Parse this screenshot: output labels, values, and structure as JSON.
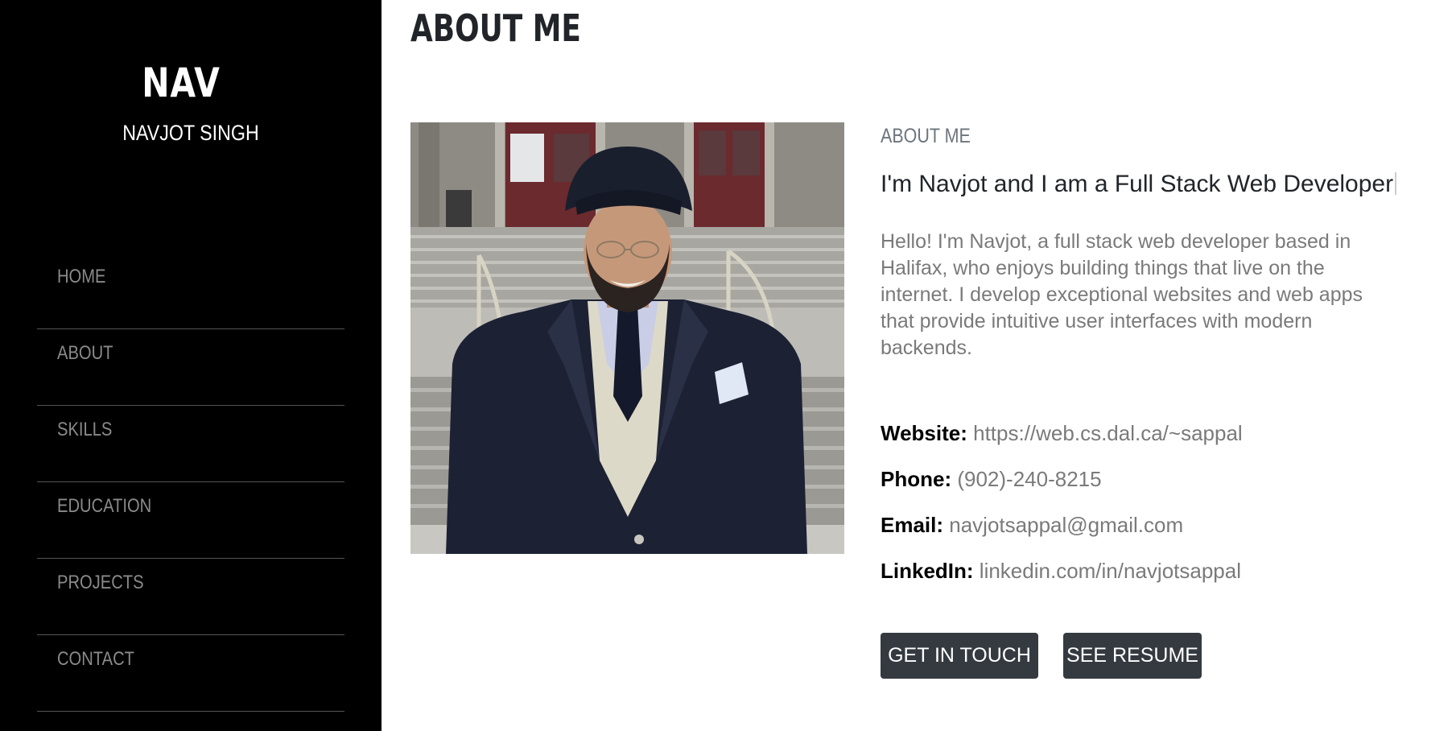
{
  "sidebar": {
    "logo": "NAV",
    "name": "NAVJOT SINGH",
    "nav_items": [
      {
        "label": "HOME"
      },
      {
        "label": "ABOUT"
      },
      {
        "label": "SKILLS"
      },
      {
        "label": "EDUCATION"
      },
      {
        "label": "PROJECTS"
      },
      {
        "label": "CONTACT"
      }
    ]
  },
  "main": {
    "page_title": "ABOUT ME",
    "section_label": "ABOUT ME",
    "headline": "I'm Navjot and I am a Full Stack Web Developer",
    "intro": "Hello! I'm Navjot, a full stack web developer based in Halifax, who enjoys building things that live on the internet. I develop exceptional websites and web apps that provide intuitive user interfaces with modern backends.",
    "info": {
      "website_label": "Website:",
      "website_value": "https://web.cs.dal.ca/~sappal",
      "phone_label": "Phone:",
      "phone_value": "(902)-240-8215",
      "email_label": "Email:",
      "email_value": "navjotsappal@gmail.com",
      "linkedin_label": "LinkedIn:",
      "linkedin_value": "linkedin.com/in/navjotsappal"
    },
    "buttons": {
      "get_in_touch": "GET IN TOUCH",
      "see_resume": "SEE RESUME"
    }
  },
  "colors": {
    "sidebar_bg": "#000000",
    "nav_text": "#8a8a8a",
    "button_bg": "#343a40",
    "muted_text": "#7a7a7a"
  }
}
